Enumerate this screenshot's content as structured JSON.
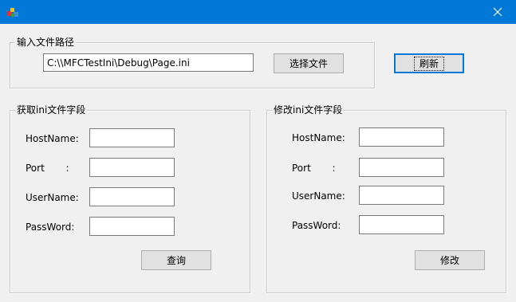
{
  "titlebar": {
    "close_glyph": "✕"
  },
  "path_group": {
    "title": "输入文件路径",
    "path_value": "C:\\\\MFCTestIni\\Debug\\Page.ini",
    "choose_file_label": "选择文件"
  },
  "refresh_label": "刷新",
  "read_group": {
    "title": "获取ini文件字段",
    "hostname_label": "HostName:",
    "port_label": "Port       :",
    "username_label": "UserName:",
    "password_label": "PassWord:",
    "hostname_value": "",
    "port_value": "",
    "username_value": "",
    "password_value": "",
    "query_label": "查询"
  },
  "edit_group": {
    "title": "修改ini文件字段",
    "hostname_label": "HostName:",
    "port_label": "Port       :",
    "username_label": "UserName:",
    "password_label": "PassWord:",
    "hostname_value": "",
    "port_value": "",
    "username_value": "",
    "password_value": "",
    "modify_label": "修改"
  },
  "colors": {
    "titlebar": "#0078d7",
    "dialog_bg": "#f0f0f0",
    "button_bg": "#e1e1e1"
  }
}
